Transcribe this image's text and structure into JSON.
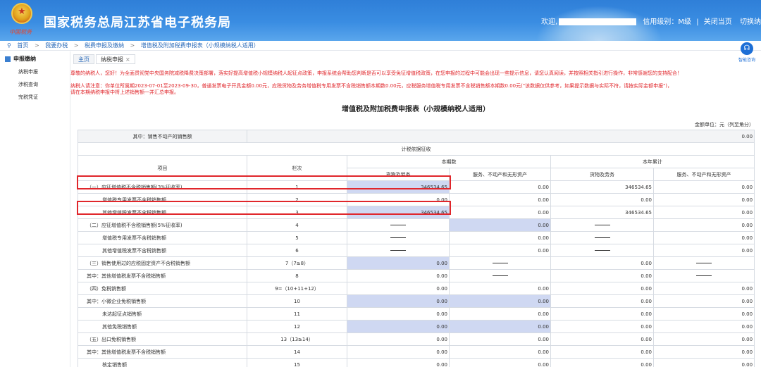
{
  "header": {
    "title": "国家税务总局江苏省电子税务局",
    "emblem_caption": "中国税务",
    "welcome": "欢迎,",
    "credit_level": "信用级别：M级",
    "close_page": "关闭当页",
    "switch_taxpayer": "切换纳税人"
  },
  "breadcrumb": {
    "items": [
      "首页",
      "我要办税",
      "税费申报及缴纳",
      "增值税及附加税费申报表（小规模纳税人适用）"
    ]
  },
  "sidebar": {
    "group": "申报缴纳",
    "items": [
      "纳税申报",
      "涉税查询",
      "完税凭证"
    ]
  },
  "tabs": [
    {
      "label": "主页"
    },
    {
      "label": "纳税申报"
    }
  ],
  "assistant": {
    "label": "智能咨询"
  },
  "notices": {
    "line1": "尊敬的纳税人，您好！为全面贯彻党中央国务院减税降费决策部署，落实好提高增值税小规模纳税人起征点政策，申报系统会帮助您判断是否可以享受免征增值税政策，在您申报的过程中可能会出现一些提示信息，请您认真阅读，并按照相关指引进行操作，非常感谢您的支持配合！",
    "line2": "纳税人请注意：你单位所属期2023-07-01至2023-09-30，普通发票电子开具金额0.00元，应税货物及劳务增值税专用发票不含税销售额本期数0.00元，应税服务增值税专用发票不含税销售额本期数0.00元(\"该数据仅供参考，如果提示数据与实际不符，请按实际金额申报\")，",
    "line3": "请在本期纳税申报中将上述销售额一并汇总申报。"
  },
  "form": {
    "title": "增值税及附加税费申报表（小规模纳税人适用）",
    "unit_note": "金额单位：元（列至角分）",
    "top_row_label": "其中：销售不动产的销售额",
    "top_row_value": "0.00",
    "section_header": "计税依据征收",
    "col_item": "项目",
    "col_line": "栏次",
    "col_current": "本期数",
    "col_ytd": "本年累计",
    "col_goods": "货物及劳务",
    "col_services": "服务、不动产和无形资产",
    "rows": [
      {
        "label": "（一）应征增值税不含税销售额(3%征收率)",
        "indent": 1,
        "line": "1",
        "cur_goods": "346534.65",
        "cur_serv": "0.00",
        "ytd_goods": "346534.65",
        "ytd_serv": "0.00",
        "g_dash": false,
        "yg_dash": false,
        "ys_dash": false,
        "g_blue": true,
        "s_blue": false
      },
      {
        "label": "增值税专用发票不含税销售额",
        "indent": 2,
        "line": "2",
        "cur_goods": "0.00",
        "cur_serv": "0.00",
        "ytd_goods": "0.00",
        "ytd_serv": "0.00",
        "g_dash": false,
        "yg_dash": false,
        "ys_dash": false,
        "g_blue": false,
        "s_blue": false
      },
      {
        "label": "其他增值税发票不含税销售额",
        "indent": 2,
        "line": "3",
        "cur_goods": "346534.65",
        "cur_serv": "0.00",
        "ytd_goods": "346534.65",
        "ytd_serv": "0.00",
        "g_dash": false,
        "yg_dash": false,
        "ys_dash": false,
        "g_blue": true,
        "s_blue": false
      },
      {
        "label": "（二）应征增值税不含税销售额(5%征收率)",
        "indent": 1,
        "line": "4",
        "cur_goods": "",
        "cur_serv": "0.00",
        "ytd_goods": "",
        "ytd_serv": "0.00",
        "g_dash": true,
        "yg_dash": true,
        "ys_dash": false,
        "g_blue": false,
        "s_blue": true
      },
      {
        "label": "增值税专用发票不含税销售额",
        "indent": 2,
        "line": "5",
        "cur_goods": "",
        "cur_serv": "0.00",
        "ytd_goods": "",
        "ytd_serv": "0.00",
        "g_dash": true,
        "yg_dash": true,
        "ys_dash": false,
        "g_blue": false,
        "s_blue": false
      },
      {
        "label": "其他增值税发票不含税销售额",
        "indent": 2,
        "line": "6",
        "cur_goods": "",
        "cur_serv": "0.00",
        "ytd_goods": "",
        "ytd_serv": "0.00",
        "g_dash": true,
        "yg_dash": true,
        "ys_dash": false,
        "g_blue": false,
        "s_blue": false
      },
      {
        "label": "（三）销售使用过的应税固定资产不含税销售额",
        "indent": 1,
        "line": "7（7≥8）",
        "cur_goods": "0.00",
        "cur_serv": "",
        "ytd_goods": "0.00",
        "ytd_serv": "",
        "g_dash": false,
        "yg_dash": false,
        "ys_dash": true,
        "s_dash": true,
        "g_blue": true,
        "s_blue": false
      },
      {
        "label": "其中：其他增值税发票不含税销售额",
        "indent": 1,
        "line": "8",
        "cur_goods": "0.00",
        "cur_serv": "",
        "ytd_goods": "0.00",
        "ytd_serv": "",
        "g_dash": false,
        "yg_dash": false,
        "ys_dash": true,
        "s_dash": true,
        "g_blue": false,
        "s_blue": false
      },
      {
        "label": "（四）免税销售额",
        "indent": 1,
        "line": "9=（10+11+12）",
        "cur_goods": "0.00",
        "cur_serv": "0.00",
        "ytd_goods": "0.00",
        "ytd_serv": "0.00",
        "g_dash": false,
        "yg_dash": false,
        "ys_dash": false,
        "g_blue": false,
        "s_blue": false
      },
      {
        "label": "其中：小微企业免税销售额",
        "indent": 1,
        "line": "10",
        "cur_goods": "0.00",
        "cur_serv": "0.00",
        "ytd_goods": "0.00",
        "ytd_serv": "0.00",
        "g_dash": false,
        "yg_dash": false,
        "ys_dash": false,
        "g_blue": true,
        "s_blue": true
      },
      {
        "label": "未达起征点销售额",
        "indent": 2,
        "line": "11",
        "cur_goods": "0.00",
        "cur_serv": "0.00",
        "ytd_goods": "0.00",
        "ytd_serv": "0.00",
        "g_dash": false,
        "yg_dash": false,
        "ys_dash": false,
        "g_blue": false,
        "s_blue": false
      },
      {
        "label": "其他免税销售额",
        "indent": 2,
        "line": "12",
        "cur_goods": "0.00",
        "cur_serv": "0.00",
        "ytd_goods": "0.00",
        "ytd_serv": "0.00",
        "g_dash": false,
        "yg_dash": false,
        "ys_dash": false,
        "g_blue": true,
        "s_blue": true
      },
      {
        "label": "（五）出口免税销售额",
        "indent": 1,
        "line": "13（13≥14）",
        "cur_goods": "0.00",
        "cur_serv": "0.00",
        "ytd_goods": "0.00",
        "ytd_serv": "0.00",
        "g_dash": false,
        "yg_dash": false,
        "ys_dash": false,
        "g_blue": false,
        "s_blue": false
      },
      {
        "label": "其中：其他增值税发票不含税销售额",
        "indent": 1,
        "line": "14",
        "cur_goods": "0.00",
        "cur_serv": "0.00",
        "ytd_goods": "0.00",
        "ytd_serv": "0.00",
        "g_dash": false,
        "yg_dash": false,
        "ys_dash": false,
        "g_blue": false,
        "s_blue": false
      },
      {
        "label": "核定销售额",
        "indent": 2,
        "line": "15",
        "cur_goods": "0.00",
        "cur_serv": "0.00",
        "ytd_goods": "0.00",
        "ytd_serv": "0.00",
        "g_dash": false,
        "yg_dash": false,
        "ys_dash": false,
        "g_blue": false,
        "s_blue": false
      }
    ]
  },
  "colors": {
    "header_blue": "#3a8de2",
    "notice_red": "#e0262b",
    "input_blue": "#cfd8f2",
    "highlight_red": "#e0262b"
  }
}
